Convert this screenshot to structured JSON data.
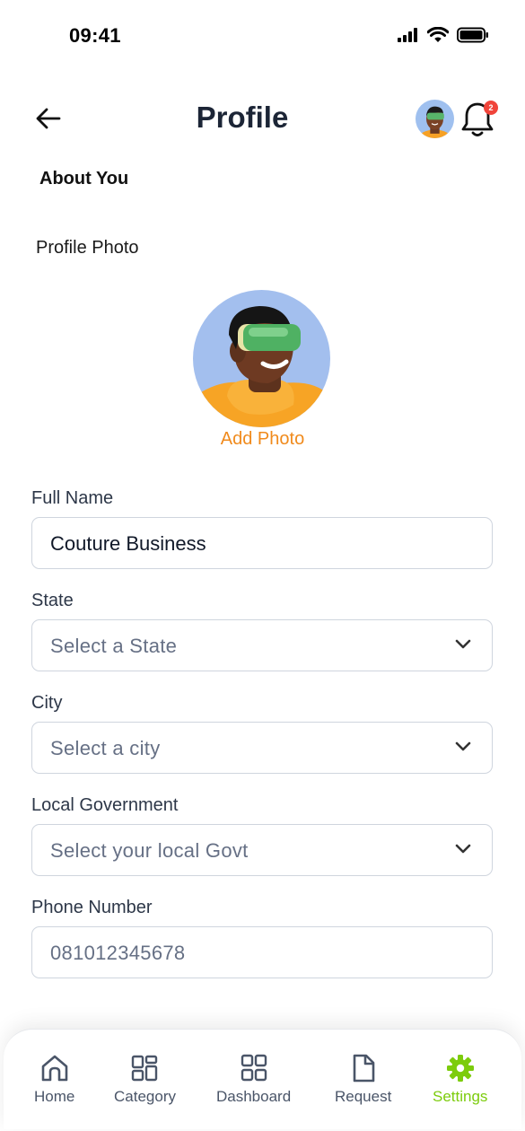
{
  "status_bar": {
    "time": "09:41"
  },
  "header": {
    "title": "Profile",
    "notification_count": "2"
  },
  "section": {
    "heading": "About You",
    "photo_label": "Profile Photo",
    "add_photo": "Add Photo"
  },
  "form": {
    "full_name": {
      "label": "Full Name",
      "value": "Couture Business"
    },
    "state": {
      "label": "State",
      "placeholder": "Select a State"
    },
    "city": {
      "label": "City",
      "placeholder": "Select a city"
    },
    "local_government": {
      "label": "Local Government",
      "placeholder": "Select your local Govt"
    },
    "phone": {
      "label": "Phone Number",
      "placeholder": "081012345678"
    }
  },
  "nav": {
    "items": [
      {
        "label": "Home",
        "icon": "home-icon"
      },
      {
        "label": "Category",
        "icon": "grid-icon"
      },
      {
        "label": "Dashboard",
        "icon": "dashboard-icon"
      },
      {
        "label": "Request",
        "icon": "document-icon"
      },
      {
        "label": "Settings",
        "icon": "gear-icon"
      }
    ],
    "active_color": "#7ccc0c"
  },
  "colors": {
    "accent_orange": "#f08a1c",
    "badge_red": "#f0443a",
    "active_green": "#7ccc0c"
  }
}
